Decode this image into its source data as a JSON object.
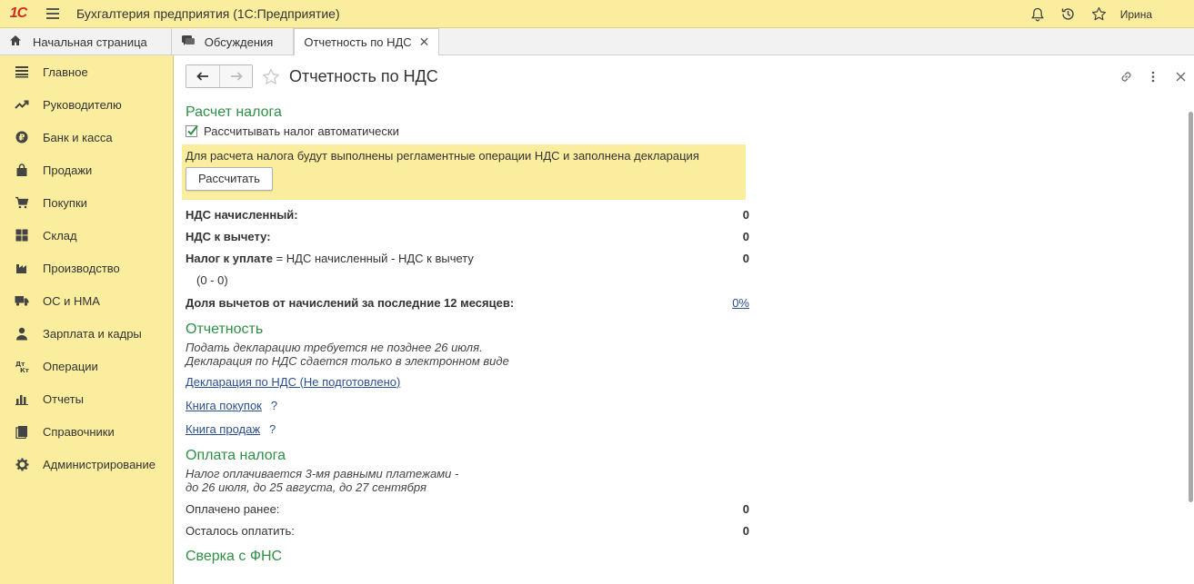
{
  "header": {
    "logo_text": "1С",
    "app_title": "Бухгалтерия предприятия  (1С:Предприятие)",
    "user": "Ирина",
    "accent": "#fbed9e"
  },
  "tabs": [
    {
      "label": "Начальная страница",
      "icon": "home-icon"
    },
    {
      "label": "Обсуждения",
      "icon": "chat-icon"
    },
    {
      "label": "Отчетность по НДС",
      "icon": "",
      "active": true
    }
  ],
  "sidebar": {
    "items": [
      {
        "label": "Главное",
        "icon": "list-icon"
      },
      {
        "label": "Руководителю",
        "icon": "trend-icon"
      },
      {
        "label": "Банк и касса",
        "icon": "ruble-icon"
      },
      {
        "label": "Продажи",
        "icon": "bag-icon"
      },
      {
        "label": "Покупки",
        "icon": "cart-icon"
      },
      {
        "label": "Склад",
        "icon": "grid-icon"
      },
      {
        "label": "Производство",
        "icon": "factory-icon"
      },
      {
        "label": "ОС и НМА",
        "icon": "truck-icon"
      },
      {
        "label": "Зарплата и кадры",
        "icon": "person-icon"
      },
      {
        "label": "Операции",
        "icon": "dtkt-icon"
      },
      {
        "label": "Отчеты",
        "icon": "barchart-icon"
      },
      {
        "label": "Справочники",
        "icon": "book-icon"
      },
      {
        "label": "Администрирование",
        "icon": "gear-icon"
      }
    ]
  },
  "page": {
    "title": "Отчетность по НДС",
    "tax_calc": {
      "heading": "Расчет налога",
      "auto_checkbox_label": "Рассчитывать налог автоматически",
      "auto_checked": true,
      "notice": "Для расчета налога будут выполнены регламентные операции НДС и заполнена декларация",
      "calc_button": "Рассчитать",
      "accrued_label": "НДС начисленный:",
      "accrued_value": "0",
      "deduction_label": "НДС к вычету:",
      "deduction_value": "0",
      "payable_label_bold": "Налог к уплате",
      "payable_label_rest": " = НДС начисленный - НДС к вычету",
      "payable_value": "0",
      "formula": "(0 - 0)",
      "share_label": "Доля вычетов от начислений за последние 12 месяцев:",
      "share_value": "0%"
    },
    "reporting": {
      "heading": "Отчетность",
      "note_line1": "Подать декларацию требуется не позднее 26 июля.",
      "note_line2": "Декларация по НДС сдается только в электронном виде",
      "declaration_link": "Декларация по НДС (Не подготовлено)",
      "purchase_book_link": "Книга покупок",
      "sales_book_link": "Книга продаж",
      "help_mark": "?"
    },
    "payment": {
      "heading": "Оплата налога",
      "note_line1": "Налог оплачивается 3-мя равными платежами -",
      "note_line2": "до 26 июля, до 25 августа, до 27 сентября",
      "paid_label": "Оплачено ранее:",
      "paid_value": "0",
      "remaining_label": "Осталось оплатить:",
      "remaining_value": "0"
    },
    "fns": {
      "heading": "Сверка с ФНС"
    }
  }
}
